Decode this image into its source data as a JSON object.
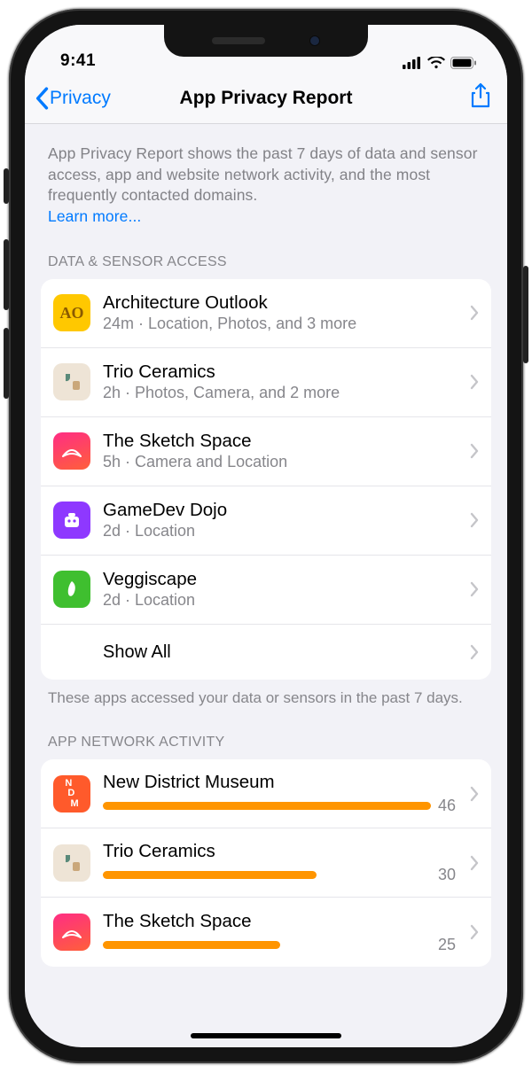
{
  "status": {
    "time": "9:41"
  },
  "nav": {
    "back_label": "Privacy",
    "title": "App Privacy Report"
  },
  "intro": {
    "text": "App Privacy Report shows the past 7 days of data and sensor access, app and website network activity, and the most frequently contacted domains.",
    "learn_more": "Learn more..."
  },
  "sections": {
    "data_sensor": {
      "header": "Data & Sensor Access",
      "footer": "These apps accessed your data or sensors in the past 7 days.",
      "show_all": "Show All",
      "items": [
        {
          "name": "Architecture Outlook",
          "detail": "24m · Location, Photos, and 3 more"
        },
        {
          "name": "Trio Ceramics",
          "detail": "2h · Photos, Camera, and 2 more"
        },
        {
          "name": "The Sketch Space",
          "detail": "5h · Camera and Location"
        },
        {
          "name": "GameDev Dojo",
          "detail": "2d · Location"
        },
        {
          "name": "Veggiscape",
          "detail": "2d · Location"
        }
      ]
    },
    "network": {
      "header": "App Network Activity",
      "max": 46,
      "items": [
        {
          "name": "New District Museum",
          "count": "46"
        },
        {
          "name": "Trio Ceramics",
          "count": "30"
        },
        {
          "name": "The Sketch Space",
          "count": "25"
        }
      ]
    }
  }
}
